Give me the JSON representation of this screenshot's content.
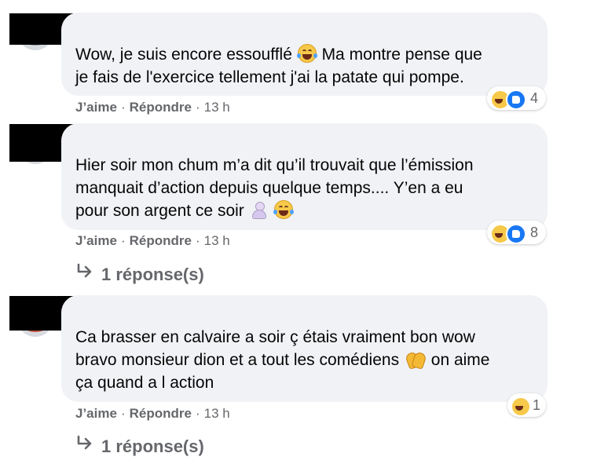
{
  "comments": [
    {
      "lines": [
        "Wow, je suis encore essoufflé",
        "Ma montre pense que",
        "je fais de l'exercice tellement j'ai la patate qui pompe."
      ],
      "actions": {
        "like": "J’aime",
        "separator": "·",
        "reply": "Répondre",
        "time": "13 h"
      },
      "reactions": {
        "icons": [
          "laughing-emoji-icon",
          "like-icon"
        ],
        "count": "4"
      }
    },
    {
      "lines": [
        "Hier soir mon chum m’a dit qu’il trouvait que l’émission",
        "manquait d’action depuis quelque temps.... Y’en a eu",
        "pour son argent ce soir"
      ],
      "actions": {
        "like": "J’aime",
        "separator": "·",
        "reply": "Répondre",
        "time": "13 h"
      },
      "reactions": {
        "icons": [
          "laughing-emoji-icon",
          "like-icon"
        ],
        "count": "8"
      },
      "replies": {
        "icon": "reply-arrow-icon",
        "label": "1 réponse(s)"
      }
    },
    {
      "lines": [
        "Ca brasser en calvaire a soir ç étais vraiment bon wow",
        "bravo monsieur dion et a tout les comédiens",
        "on aime",
        "ça quand a l action"
      ],
      "actions": {
        "like": "J’aime",
        "separator": "·",
        "reply": "Répondre",
        "time": "13 h"
      },
      "reactions": {
        "icons": [
          "laughing-emoji-icon"
        ],
        "count": "1"
      },
      "replies": {
        "icon": "reply-arrow-icon",
        "label": "1 réponse(s)"
      }
    }
  ],
  "colors": {
    "bubble": "#f0f2f5",
    "secondary_text": "#65676b",
    "primary_text": "#050505",
    "like_blue": "#1877f2",
    "laugh_yellow": "#f7c94a",
    "redaction": "#000000"
  }
}
